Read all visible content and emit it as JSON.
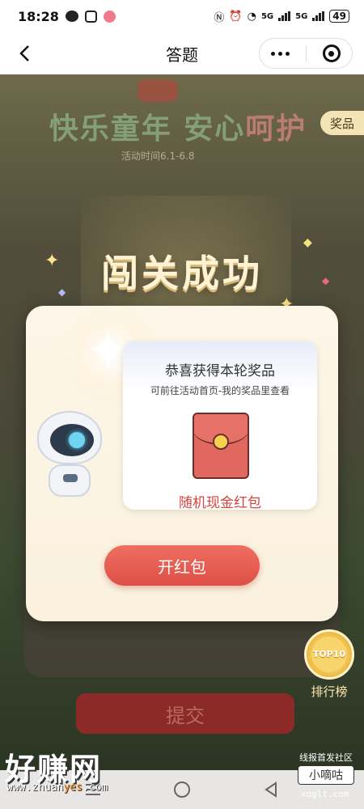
{
  "status_bar": {
    "time": "18:28",
    "battery": "49",
    "network": "5G"
  },
  "nav": {
    "title": "答题"
  },
  "background": {
    "banner_part1": "快乐童年 安心",
    "banner_part2": "呵护",
    "activity_time": "活动时间6.1-6.8",
    "prize_tab": "奖品",
    "success_title": "闯关成功",
    "submit": "提交"
  },
  "modal": {
    "congrats": "恭喜获得本轮奖品",
    "hint": "可前往活动首页-我的奖品里查看",
    "prize_name": "随机现金红包",
    "open_button": "开红包"
  },
  "ranking": {
    "badge_top": "TOP",
    "badge_num": "10",
    "label": "排行榜"
  },
  "watermark": {
    "big": "好赚网",
    "url_pre": "www.zhuan",
    "url_hl": "yes",
    "url_post": ".com",
    "right_top": "线报首发社区",
    "right_box": "小嘀咕",
    "right_url": "xdglt.com"
  },
  "colors": {
    "accent": "#de4f45",
    "gold": "#f0c24e",
    "modal_bg": "#fdf6e8"
  }
}
